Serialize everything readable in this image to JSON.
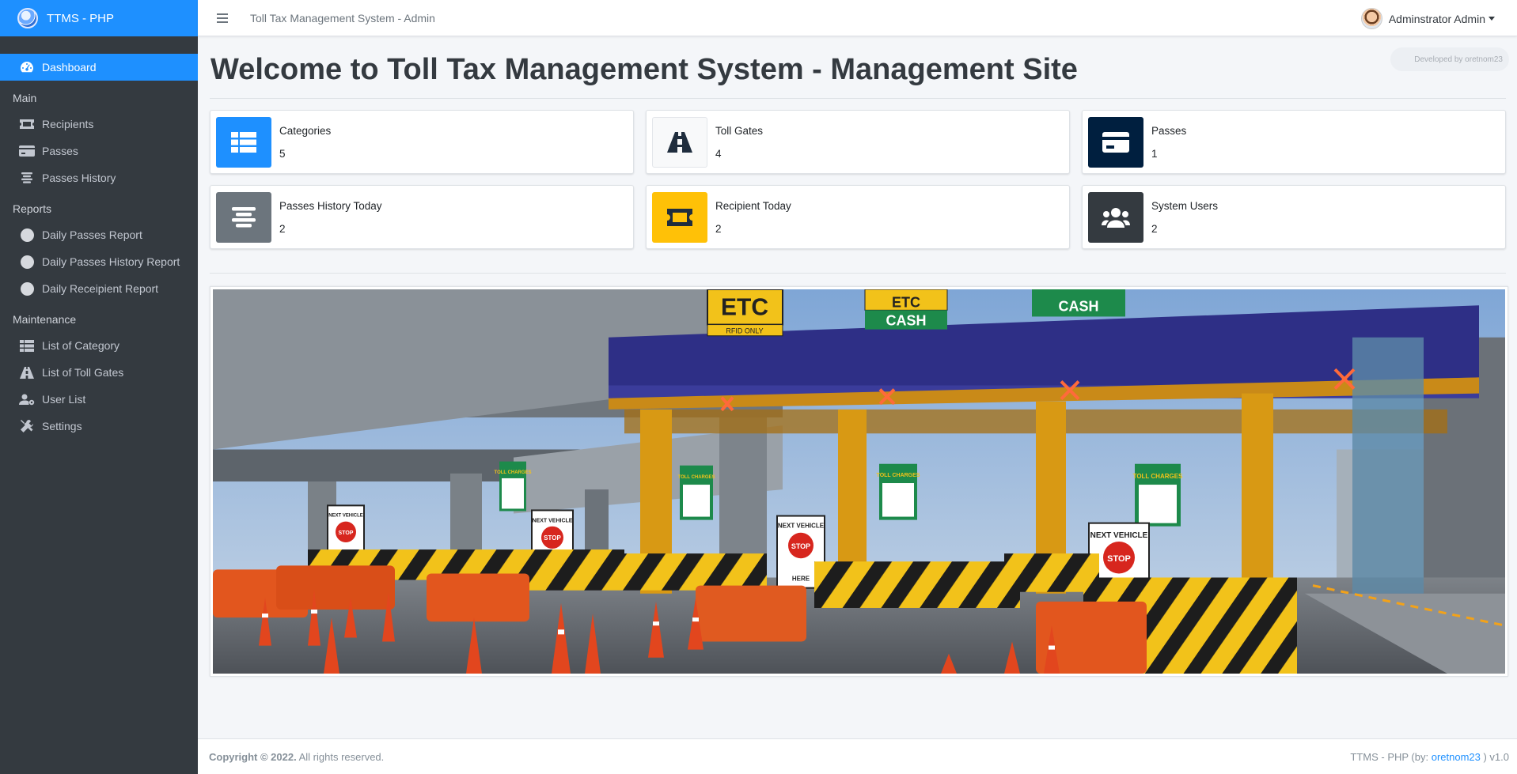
{
  "brand": {
    "name": "TTMS - PHP"
  },
  "topbar": {
    "title": "Toll Tax Management System - Admin",
    "user": "Adminstrator Admin"
  },
  "sidebar": {
    "dashboard": "Dashboard",
    "main_header": "Main",
    "main_items": [
      "Recipients",
      "Passes",
      "Passes History"
    ],
    "reports_header": "Reports",
    "report_items": [
      "Daily Passes Report",
      "Daily Passes History Report",
      "Daily Receipient Report"
    ],
    "maintenance_header": "Maintenance",
    "maintenance_items": [
      "List of Category",
      "List of Toll Gates",
      "User List",
      "Settings"
    ]
  },
  "content": {
    "developed_by": "Developed by oretnom23",
    "title": "Welcome to Toll Tax Management System - Management Site",
    "cards": [
      {
        "label": "Categories",
        "value": "5",
        "icon": "table-icon",
        "color": "#1e90ff"
      },
      {
        "label": "Toll Gates",
        "value": "4",
        "icon": "road-icon",
        "color": "#f8f9fa"
      },
      {
        "label": "Passes",
        "value": "1",
        "icon": "credit-card-icon",
        "color": "#001f3f"
      },
      {
        "label": "Passes History Today",
        "value": "2",
        "icon": "align-center-icon",
        "color": "#6c757d"
      },
      {
        "label": "Recipient Today",
        "value": "2",
        "icon": "ticket-icon",
        "color": "#ffc107"
      },
      {
        "label": "System Users",
        "value": "2",
        "icon": "users-icon",
        "color": "#343a40"
      }
    ],
    "banner_signs": {
      "etc": "ETC",
      "rfid": "RFID ONLY",
      "etc_cash": "ETC",
      "cash": "CASH",
      "toll_charges": "TOLL CHARGES",
      "next_vehicle": "NEXT VEHICLE",
      "stop": "STOP",
      "here": "HERE"
    }
  },
  "footer": {
    "copyright": "Copyright © 2022.",
    "rights": "All rights reserved.",
    "app": "TTMS - PHP (by: ",
    "author": "oretnom23",
    "version": " ) v1.0"
  }
}
